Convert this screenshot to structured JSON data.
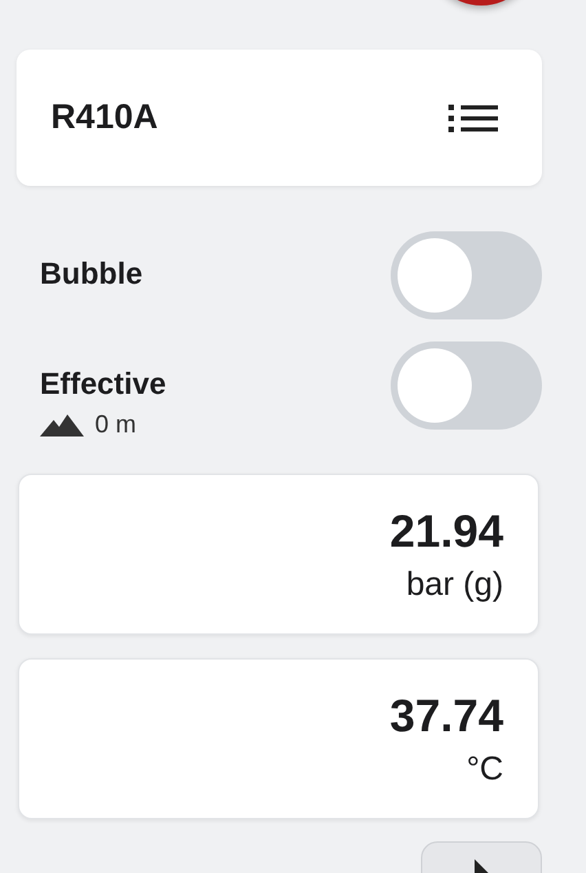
{
  "refrigerant": {
    "name": "R410A"
  },
  "toggles": [
    {
      "label": "Bubble",
      "on": false
    },
    {
      "label": "Effective",
      "on": false,
      "altitude": "0 m"
    }
  ],
  "readings": [
    {
      "value": "21.94",
      "unit": "bar (g)"
    },
    {
      "value": "37.74",
      "unit": "°C"
    }
  ]
}
